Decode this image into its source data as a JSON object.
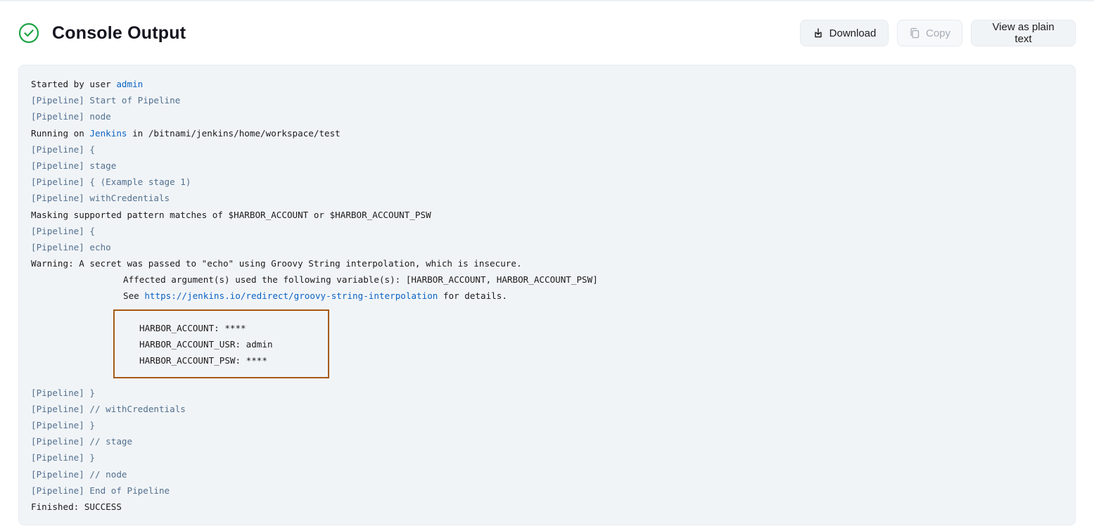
{
  "header": {
    "title": "Console Output",
    "status_icon": "check-circle-icon",
    "status_color": "#1ea446"
  },
  "toolbar": {
    "download_label": "Download",
    "copy_label": "Copy",
    "plain_text_label": "View as plain text"
  },
  "console": {
    "started_by_prefix": "Started by user ",
    "started_by_user": "admin",
    "pipeline_tag": "[Pipeline]",
    "l_start": " Start of Pipeline",
    "l_node": " node",
    "running_on_prefix": "Running on ",
    "running_on_agent": "Jenkins",
    "running_on_suffix": " in /bitnami/jenkins/home/workspace/test",
    "l_open1": " {",
    "l_stage": " stage",
    "l_stage_open": " { (Example stage 1)",
    "l_withcred": " withCredentials",
    "masking": "Masking supported pattern matches of $HARBOR_ACCOUNT or $HARBOR_ACCOUNT_PSW",
    "l_open2": " {",
    "l_echo": " echo",
    "warning": "Warning: A secret was passed to \"echo\" using Groovy String interpolation, which is insecure.",
    "affected": "Affected argument(s) used the following variable(s): [HARBOR_ACCOUNT, HARBOR_ACCOUNT_PSW]",
    "see_prefix": "See ",
    "see_link": "https://jenkins.io/redirect/groovy-string-interpolation",
    "see_suffix": " for details.",
    "masked": [
      "HARBOR_ACCOUNT: ****",
      "HARBOR_ACCOUNT_USR: admin",
      "HARBOR_ACCOUNT_PSW: ****"
    ],
    "l_close1": " }",
    "l_end_withcred": " // withCredentials",
    "l_close2": " }",
    "l_end_stage": " // stage",
    "l_close3": " }",
    "l_end_node": " // node",
    "l_end_pipeline": " End of Pipeline",
    "finished": "Finished: SUCCESS"
  }
}
